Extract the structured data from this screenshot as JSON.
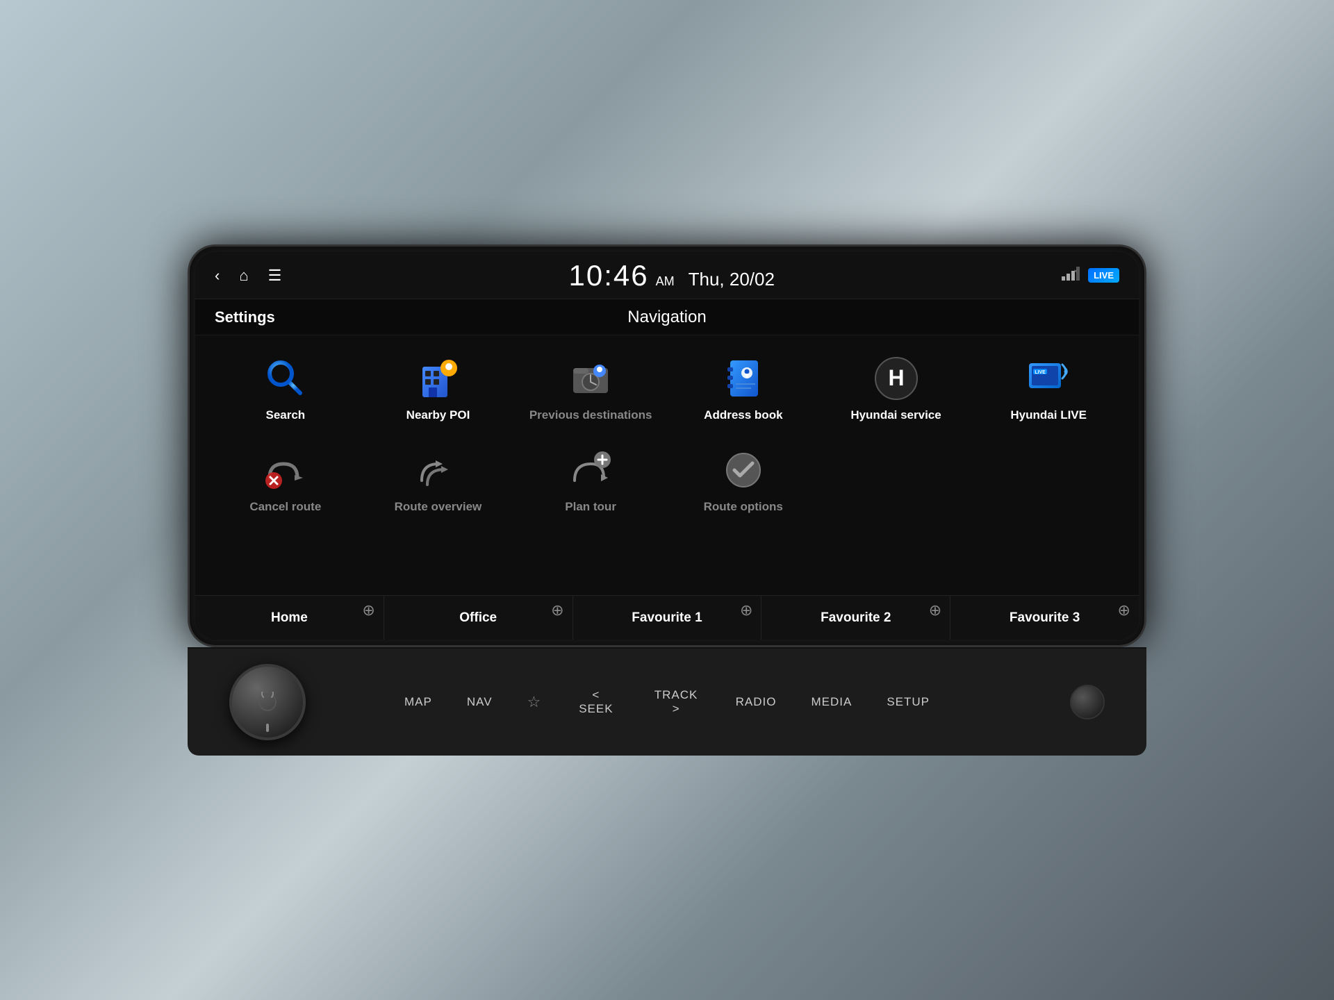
{
  "statusBar": {
    "timeHour": "10:46",
    "timeAmPm": "AM",
    "date": "Thu, 20/02",
    "liveBadge": "LIVE"
  },
  "header": {
    "settingsLabel": "Settings",
    "navTitle": "Navigation"
  },
  "menuRow1": [
    {
      "id": "search",
      "label": "Search",
      "iconType": "search",
      "active": true
    },
    {
      "id": "nearby-poi",
      "label": "Nearby POI",
      "iconType": "nearby-poi",
      "active": true
    },
    {
      "id": "previous-destinations",
      "label": "Previous destinations",
      "iconType": "previous-dest",
      "active": false
    },
    {
      "id": "address-book",
      "label": "Address book",
      "iconType": "address-book",
      "active": true
    },
    {
      "id": "hyundai-service",
      "label": "Hyundai service",
      "iconType": "hyundai-service",
      "active": true
    },
    {
      "id": "hyundai-live",
      "label": "Hyundai LIVE",
      "iconType": "hyundai-live",
      "active": true
    }
  ],
  "menuRow2": [
    {
      "id": "cancel-route",
      "label": "Cancel route",
      "iconType": "cancel-route",
      "active": false
    },
    {
      "id": "route-overview",
      "label": "Route overview",
      "iconType": "route-overview",
      "active": false
    },
    {
      "id": "plan-tour",
      "label": "Plan tour",
      "iconType": "plan-tour",
      "active": false
    },
    {
      "id": "route-options",
      "label": "Route options",
      "iconType": "route-options",
      "active": false
    }
  ],
  "favourites": [
    {
      "id": "home",
      "label": "Home"
    },
    {
      "id": "office",
      "label": "Office"
    },
    {
      "id": "favourite-1",
      "label": "Favourite 1"
    },
    {
      "id": "favourite-2",
      "label": "Favourite 2"
    },
    {
      "id": "favourite-3",
      "label": "Favourite 3"
    }
  ],
  "physicalControls": {
    "map": "MAP",
    "nav": "NAV",
    "seek": "< SEEK",
    "track": "TRACK >",
    "radio": "RADIO",
    "media": "MEDIA",
    "setup": "SETUP"
  }
}
